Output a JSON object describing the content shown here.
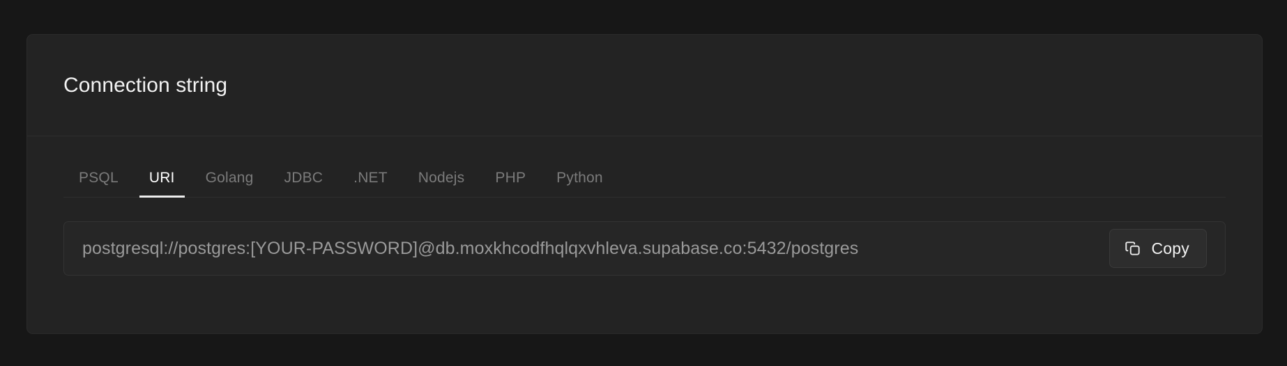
{
  "theme": {
    "page_background": "#171717",
    "card_background": "#232323",
    "accent_active": "#ffffff",
    "muted_text": "#7b7b7b",
    "value_text": "#9a9a9a"
  },
  "card": {
    "title": "Connection string"
  },
  "tabs": {
    "active_index": 1,
    "items": [
      {
        "label": "PSQL"
      },
      {
        "label": "URI"
      },
      {
        "label": "Golang"
      },
      {
        "label": "JDBC"
      },
      {
        "label": ".NET"
      },
      {
        "label": "Nodejs"
      },
      {
        "label": "PHP"
      },
      {
        "label": "Python"
      }
    ]
  },
  "connection": {
    "value": "postgresql://postgres:[YOUR-PASSWORD]@db.moxkhcodfhqlqxvhleva.supabase.co:5432/postgres",
    "placeholder": "Connection string",
    "copy_button_label": "Copy",
    "copy_icon": "copy-icon"
  }
}
